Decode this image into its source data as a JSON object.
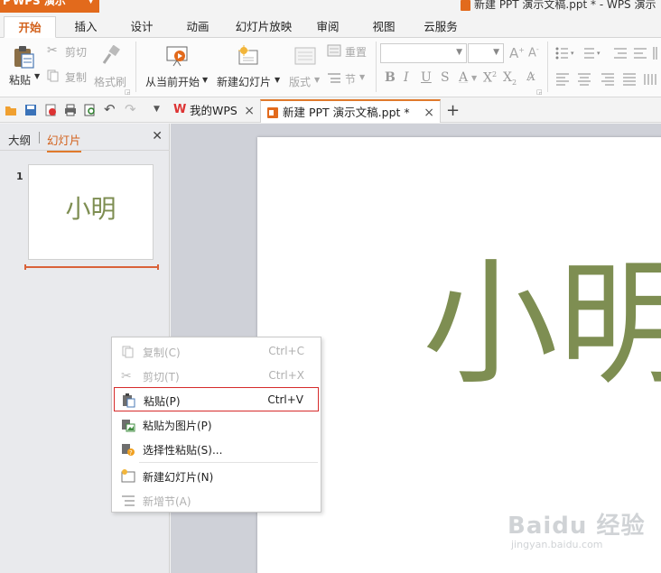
{
  "app": {
    "button_label": "WPS 演示",
    "window_title": "新建 PPT 演示文稿.ppt * - WPS 演示"
  },
  "ribbon_tabs": [
    "开始",
    "插入",
    "设计",
    "动画",
    "幻灯片放映",
    "审阅",
    "视图",
    "云服务"
  ],
  "ribbon": {
    "paste": "粘贴",
    "cut": "剪切",
    "copy": "复制",
    "format_painter": "格式刷",
    "from_current": "从当前开始",
    "new_slide": "新建幻灯片",
    "layout": "版式",
    "reset": "重置",
    "section": "节"
  },
  "doc_tabs": {
    "home": "我的WPS",
    "document": "新建 PPT 演示文稿.ppt *"
  },
  "panel": {
    "tab_outline": "大纲",
    "tab_slides": "幻灯片",
    "slide_number": "1",
    "thumb_text": "小明"
  },
  "slide": {
    "text": "小明"
  },
  "context_menu": [
    {
      "label": "复制(C)",
      "shortcut": "Ctrl+C",
      "enabled": false,
      "icon": "copy-icon"
    },
    {
      "label": "剪切(T)",
      "shortcut": "Ctrl+X",
      "enabled": false,
      "icon": "scissors-icon"
    },
    {
      "label": "粘贴(P)",
      "shortcut": "Ctrl+V",
      "enabled": true,
      "icon": "paste-icon",
      "highlighted": true
    },
    {
      "label": "粘贴为图片(P)",
      "shortcut": "",
      "enabled": true,
      "icon": "paste-as-picture-icon"
    },
    {
      "label": "选择性粘贴(S)...",
      "shortcut": "",
      "enabled": true,
      "icon": "paste-special-icon"
    },
    {
      "label": "新建幻灯片(N)",
      "shortcut": "",
      "enabled": true,
      "icon": "new-slide-icon"
    },
    {
      "label": "新增节(A)",
      "shortcut": "",
      "enabled": false,
      "icon": "new-section-icon"
    }
  ],
  "watermark": {
    "main": "Baidu 经验",
    "sub": "jingyan.baidu.com"
  },
  "colors": {
    "accent": "#e26a1c",
    "slide_text": "#7e8e52",
    "highlight_border": "#d62b2b"
  }
}
